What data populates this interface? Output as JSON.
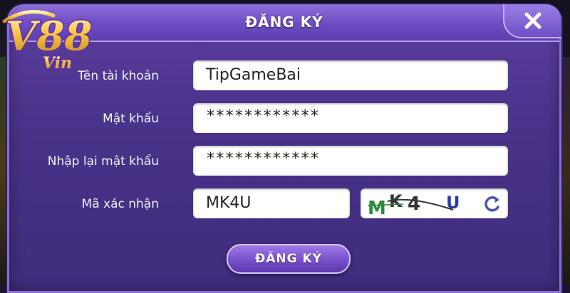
{
  "dialog": {
    "title": "ĐĂNG KÝ",
    "close_icon": "close-icon"
  },
  "logo": {
    "main_text": "V88",
    "sub_text": "Vin",
    "colors": {
      "gold": "#f6c544",
      "purple": "#6a2ca8"
    }
  },
  "form": {
    "username_label": "Tên tài khoản",
    "username_value": "TipGameBai",
    "password_label": "Mật khẩu",
    "password_value": "************",
    "confirm_label": "Nhập lại mật khẩu",
    "confirm_value": "************",
    "captcha_label": "Mã xác nhận",
    "captcha_value": "MK4U",
    "captcha_image_text": [
      "M",
      "K",
      "4",
      "U"
    ],
    "captcha_refresh_icon": "refresh-icon"
  },
  "submit_label": "ĐĂNG KÝ",
  "colors": {
    "dialog_bg": "#4a338a",
    "title_bar": "#6a4cc0",
    "border": "#8a6fd0",
    "field_bg": "#ffffff",
    "button": "#7a52cc"
  }
}
